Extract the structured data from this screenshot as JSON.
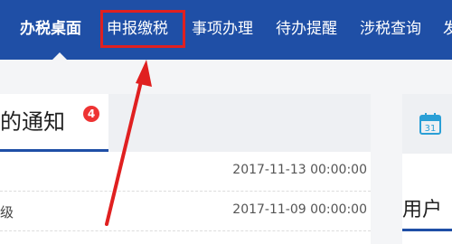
{
  "nav": {
    "items": [
      {
        "label": "办税桌面"
      },
      {
        "label": "申报缴税"
      },
      {
        "label": "事项办理"
      },
      {
        "label": "待办提醒"
      },
      {
        "label": "涉税查询"
      },
      {
        "label": "发"
      }
    ]
  },
  "notifications": {
    "title": "我的通知",
    "badge": "4",
    "rows": [
      {
        "text": "",
        "time": "2017-11-13 00:00:00"
      },
      {
        "text": "级",
        "time": "2017-11-09 00:00:00"
      }
    ]
  },
  "right_panel": {
    "calendar_day": "31",
    "title": "用户"
  },
  "colors": {
    "nav_bg": "#1f4fa6",
    "highlight": "#e02020",
    "badge": "#e33333"
  }
}
